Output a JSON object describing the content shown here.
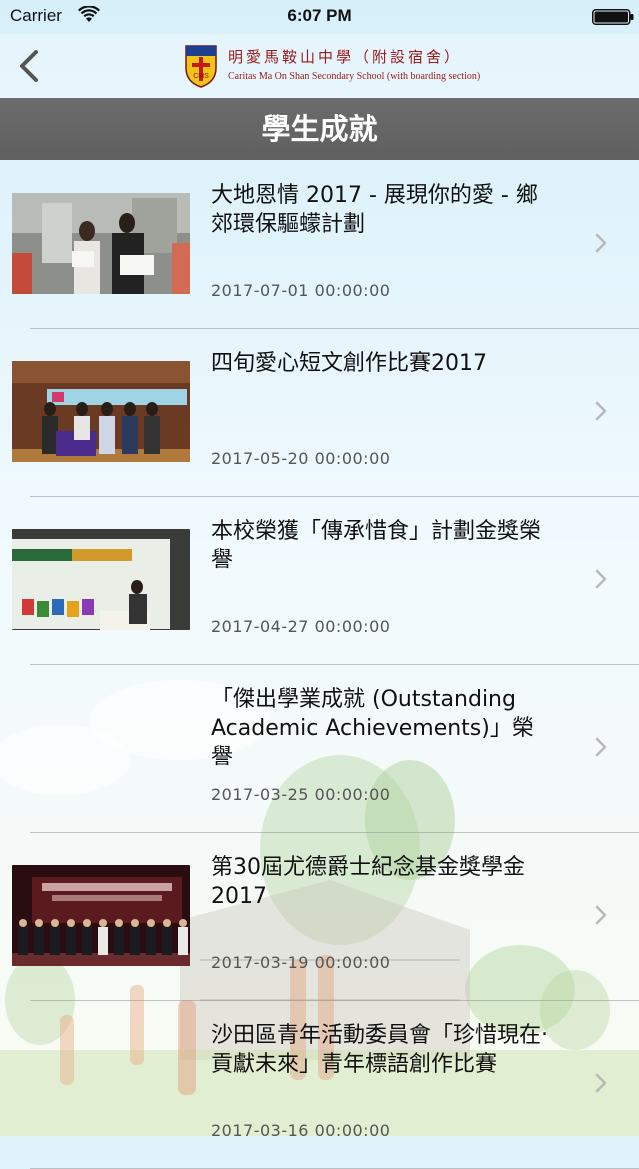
{
  "status_bar": {
    "carrier": "Carrier",
    "time": "6:07 PM",
    "wifi_icon": "wifi-icon",
    "battery_icon": "battery-icon"
  },
  "nav": {
    "back_icon": "chevron-left-icon",
    "school_name_cn": "明愛馬鞍山中學（附設宿舍）",
    "school_name_en": "Caritas Ma On Shan Secondary School (with boarding section)",
    "crest_icon": "school-crest-icon",
    "crest_text": "CMS"
  },
  "page": {
    "title": "學生成就"
  },
  "colors": {
    "title_bar": "#636363",
    "school_text": "#9a1a1a",
    "chevron": "#b8b8b8"
  },
  "items": [
    {
      "title": "大地恩情 2017 - 展現你的愛 - 鄉郊環保驅蠓計劃",
      "date": "2017-07-01 00:00:00",
      "has_image": true
    },
    {
      "title": "四旬愛心短文創作比賽2017",
      "date": "2017-05-20 00:00:00",
      "has_image": true
    },
    {
      "title": "本校榮獲「傳承惜食」計劃金獎榮譽",
      "date": "2017-04-27 00:00:00",
      "has_image": true
    },
    {
      "title": "「傑出學業成就 (Outstanding Academic Achievements)」榮譽",
      "date": "2017-03-25 00:00:00",
      "has_image": false
    },
    {
      "title": "第30屆尤德爵士紀念基金獎學金2017",
      "date": "2017-03-19 00:00:00",
      "has_image": true
    },
    {
      "title": "沙田區青年活動委員會「珍惜現在‧貢獻未來」青年標語創作比賽",
      "date": "2017-03-16 00:00:00",
      "has_image": false
    }
  ]
}
